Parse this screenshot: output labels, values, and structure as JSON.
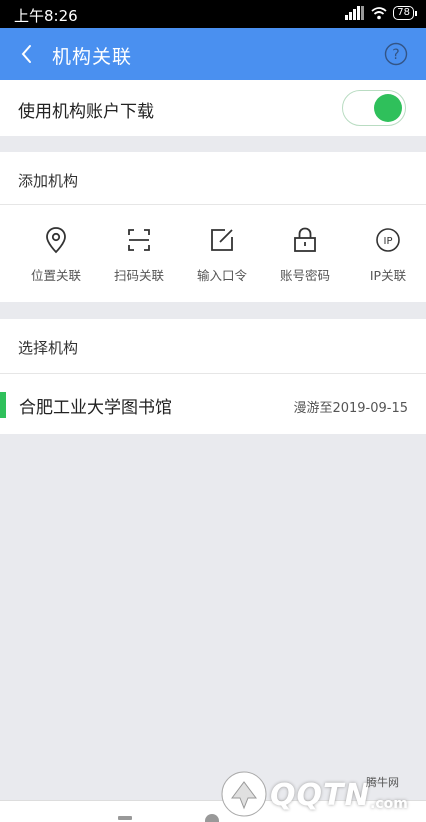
{
  "status_bar": {
    "time": "上午8:26",
    "battery": "78"
  },
  "app_bar": {
    "title": "机构关联",
    "help_icon": "question-circle-icon",
    "back_icon": "chevron-left-icon"
  },
  "download_toggle": {
    "label": "使用机构账户下载",
    "enabled": true
  },
  "add_section": {
    "title": "添加机构",
    "actions": [
      {
        "label": "位置关联",
        "icon": "location-pin-icon"
      },
      {
        "label": "扫码关联",
        "icon": "scan-icon"
      },
      {
        "label": "输入口令",
        "icon": "edit-icon"
      },
      {
        "label": "账号密码",
        "icon": "lock-icon"
      },
      {
        "label": "IP关联",
        "icon": "ip-icon"
      }
    ]
  },
  "select_section": {
    "title": "选择机构",
    "institutions": [
      {
        "name": "合肥工业大学图书馆",
        "roaming": "漫游至2019-09-15"
      }
    ]
  },
  "watermark": {
    "brand": "QQTN",
    "brand_cn": "腾牛网",
    "domain": ".com"
  },
  "colors": {
    "app_bar": "#4a90f0",
    "accent_green": "#2fc05b",
    "background": "#e9eaee"
  }
}
